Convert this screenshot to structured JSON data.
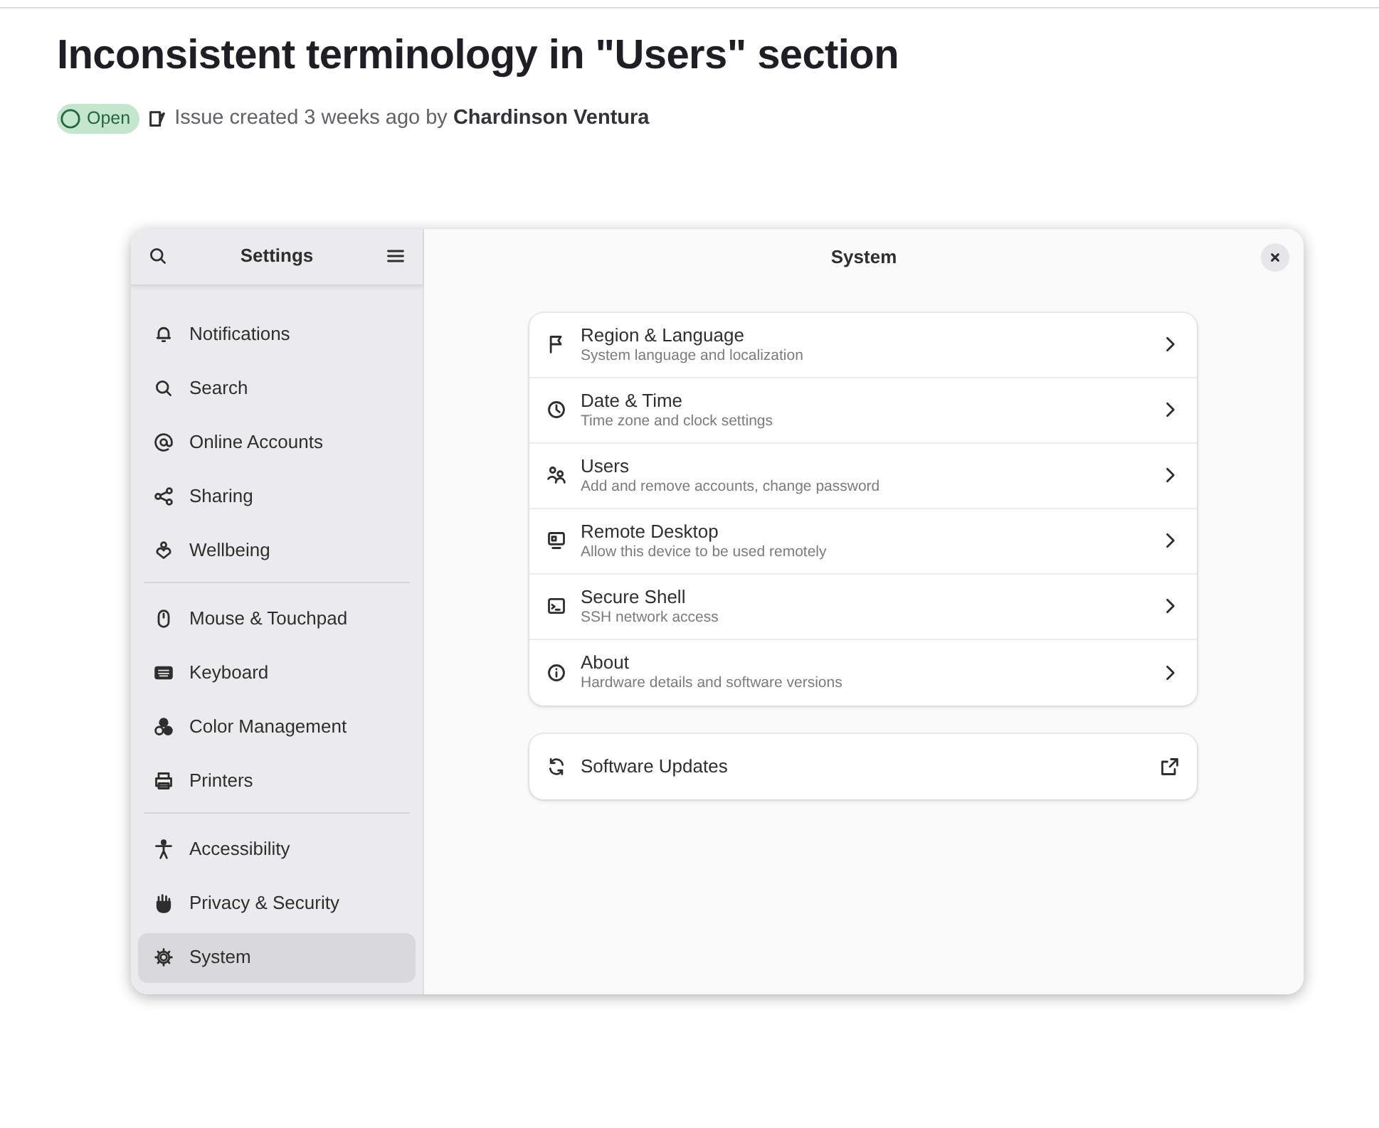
{
  "issue": {
    "title": "Inconsistent terminology in \"Users\" section",
    "status": "Open",
    "meta": "Issue created 3 weeks ago by",
    "author": "Chardinson Ventura"
  },
  "settings_window": {
    "sidebar": {
      "title": "Settings",
      "groups": [
        [
          {
            "label": "Notifications",
            "selected": false
          },
          {
            "label": "Search",
            "selected": false
          },
          {
            "label": "Online Accounts",
            "selected": false
          },
          {
            "label": "Sharing",
            "selected": false
          },
          {
            "label": "Wellbeing",
            "selected": false
          }
        ],
        [
          {
            "label": "Mouse & Touchpad",
            "selected": false
          },
          {
            "label": "Keyboard",
            "selected": false
          },
          {
            "label": "Color Management",
            "selected": false
          },
          {
            "label": "Printers",
            "selected": false
          }
        ],
        [
          {
            "label": "Accessibility",
            "selected": false
          },
          {
            "label": "Privacy & Security",
            "selected": false
          },
          {
            "label": "System",
            "selected": true
          }
        ]
      ]
    },
    "page_title": "System",
    "rows": [
      {
        "title": "Region & Language",
        "subtitle": "System language and localization"
      },
      {
        "title": "Date & Time",
        "subtitle": "Time zone and clock settings"
      },
      {
        "title": "Users",
        "subtitle": "Add and remove accounts, change password"
      },
      {
        "title": "Remote Desktop",
        "subtitle": "Allow this device to be used remotely"
      },
      {
        "title": "Secure Shell",
        "subtitle": "SSH network access"
      },
      {
        "title": "About",
        "subtitle": "Hardware details and software versions"
      }
    ],
    "extra_rows": [
      {
        "title": "Software Updates"
      }
    ]
  }
}
